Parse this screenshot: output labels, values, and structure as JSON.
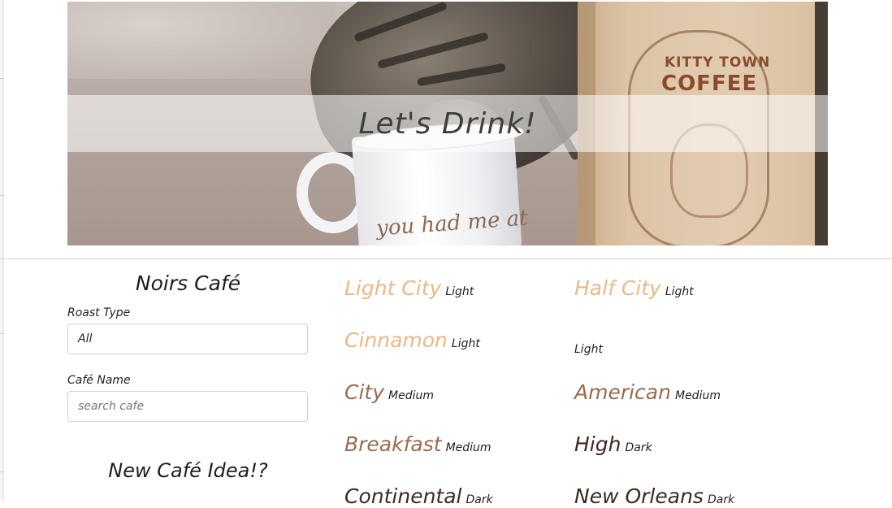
{
  "hero": {
    "banner_text": "Let's Drink!",
    "mug_text": "you had me at",
    "bag_brand_top": "KITTY TOWN",
    "bag_brand_bottom": "COFFEE"
  },
  "sidebar": {
    "title": "Noirs Café",
    "roast_label": "Roast Type",
    "roast_selected": "All",
    "name_label": "Café Name",
    "name_placeholder": "search cafe",
    "name_value": "",
    "new_idea_title": "New Café Idea!?"
  },
  "roasts": [
    {
      "name": "Light City",
      "type": "Light",
      "name_color": "#ecb886"
    },
    {
      "name": "Half City",
      "type": "Light",
      "name_color": "#ecb886"
    },
    {
      "name": "Cinnamon",
      "type": "Light",
      "name_color": "#ecb886"
    },
    {
      "name": "",
      "type": "Light",
      "name_color": "#ecb886"
    },
    {
      "name": "City",
      "type": "Medium",
      "name_color": "#9a6b4f"
    },
    {
      "name": "American",
      "type": "Medium",
      "name_color": "#9a6b4f"
    },
    {
      "name": "Breakfast",
      "type": "Medium",
      "name_color": "#9a6b4f"
    },
    {
      "name": "High",
      "type": "Dark",
      "name_color": "#3a2a24"
    },
    {
      "name": "Continental",
      "type": "Dark",
      "name_color": "#3a2a24"
    },
    {
      "name": "New Orleans",
      "type": "Dark",
      "name_color": "#3a2a24"
    }
  ]
}
